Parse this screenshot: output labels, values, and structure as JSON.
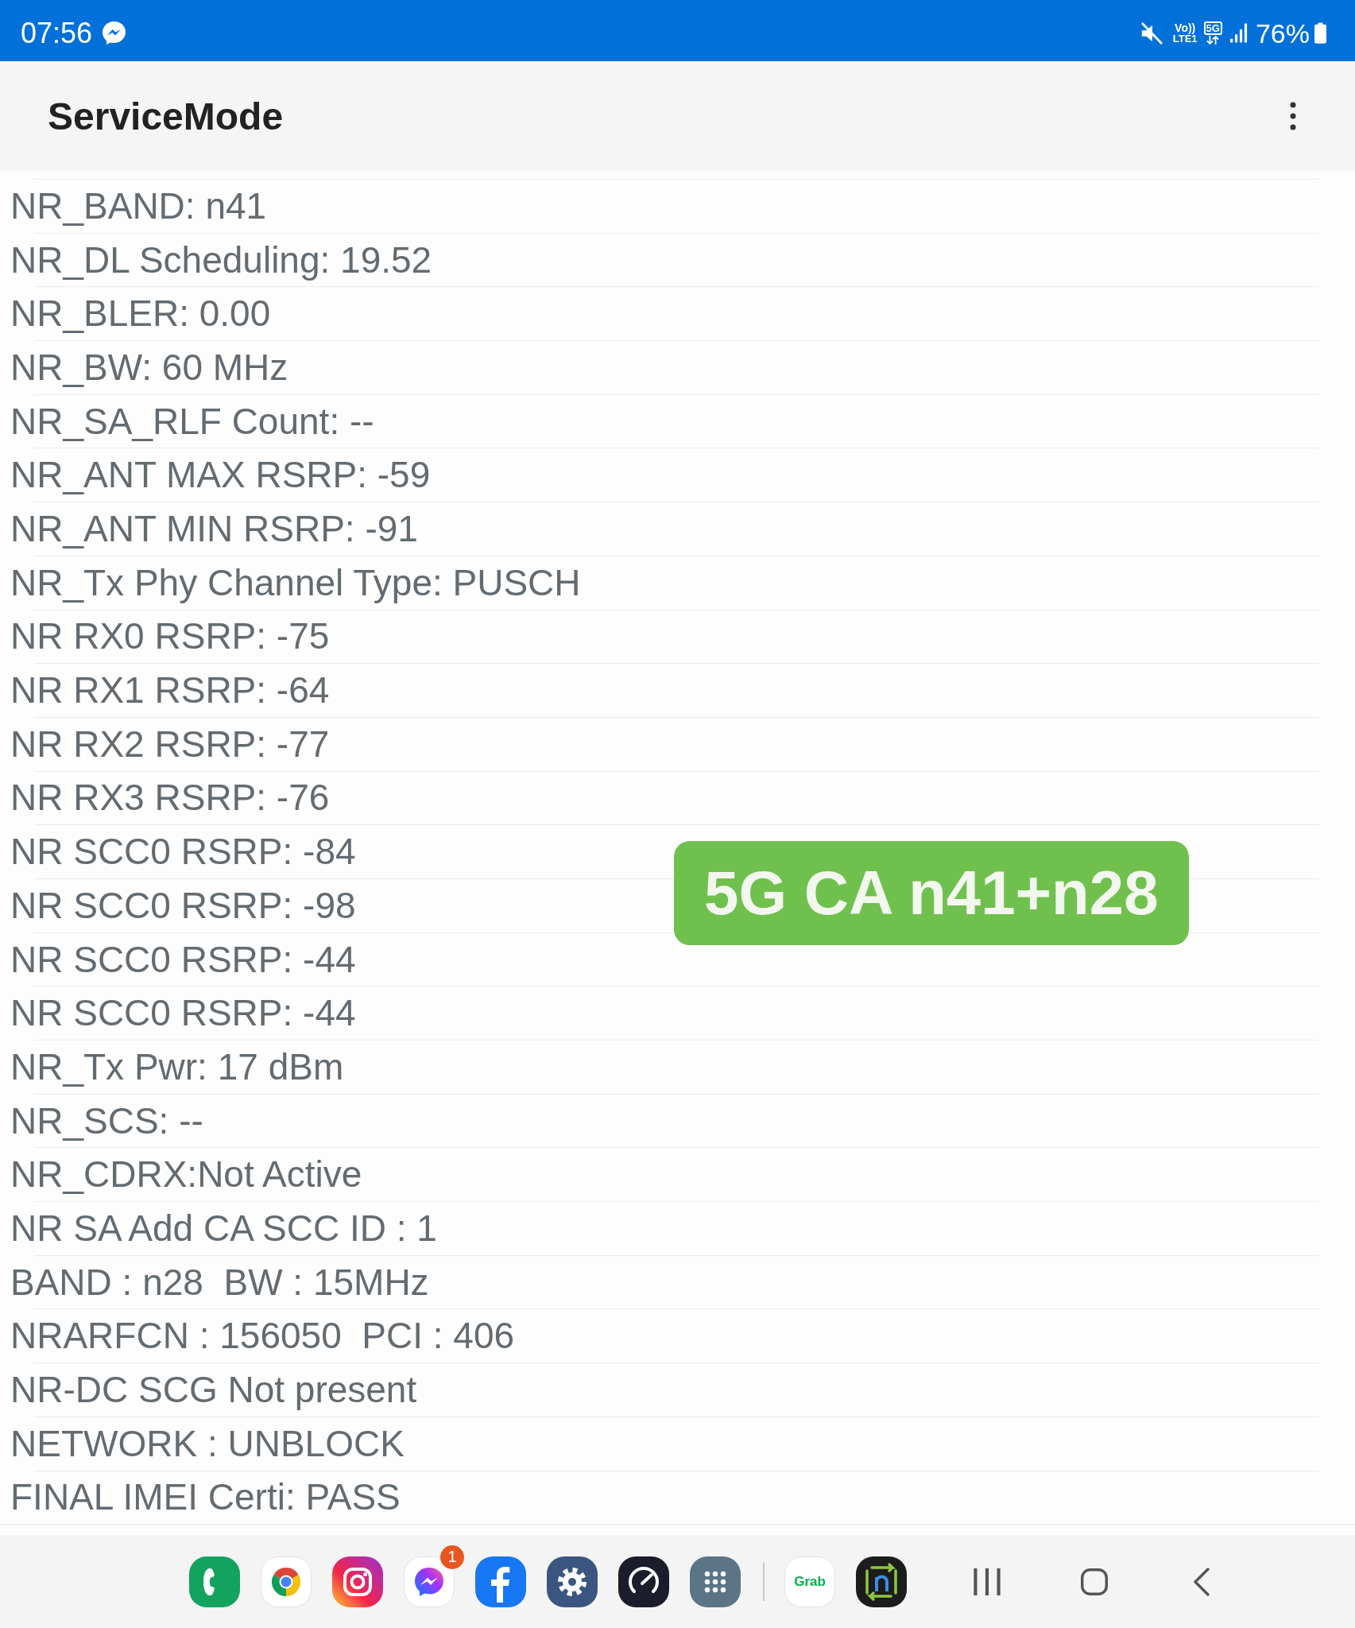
{
  "status_bar": {
    "time": "07:56",
    "volte_top": "Vo))",
    "volte_bottom": "LTE1",
    "network": "5G",
    "battery": "76%"
  },
  "app_bar": {
    "title": "ServiceMode"
  },
  "items": [
    "NR_BAND: n41",
    "NR_DL Scheduling: 19.52",
    "NR_BLER: 0.00",
    "NR_BW: 60 MHz",
    "NR_SA_RLF Count: --",
    "NR_ANT MAX RSRP: -59",
    "NR_ANT MIN RSRP: -91",
    "NR_Tx Phy Channel Type: PUSCH",
    "NR RX0 RSRP: -75",
    "NR RX1 RSRP: -64",
    "NR RX2 RSRP: -77",
    "NR RX3 RSRP: -76",
    "NR SCC0 RSRP: -84",
    "NR SCC0 RSRP: -98",
    "NR SCC0 RSRP: -44",
    "NR SCC0 RSRP: -44",
    "NR_Tx Pwr: 17 dBm",
    "NR_SCS: --",
    "NR_CDRX:Not Active",
    "NR SA Add CA SCC ID : 1",
    "BAND : n28  BW : 15MHz",
    "NRARFCN : 156050  PCI : 406",
    "NR-DC SCG Not present",
    "NETWORK : UNBLOCK",
    "FINAL IMEI Certi: PASS"
  ],
  "overlay_label": "5G CA n41+n28",
  "dock": {
    "pinned": [
      {
        "kind": "phone"
      },
      {
        "kind": "browser"
      },
      {
        "kind": "camera"
      },
      {
        "kind": "messenger",
        "badge": "1"
      },
      {
        "kind": "facebook"
      },
      {
        "kind": "settings"
      },
      {
        "kind": "speedometer"
      },
      {
        "kind": "app-grid"
      }
    ],
    "recent": [
      {
        "kind": "grab",
        "label": "Grab"
      },
      {
        "kind": "n-sync"
      }
    ]
  },
  "nav_buttons": [
    {
      "kind": "recents"
    },
    {
      "kind": "home"
    },
    {
      "kind": "back"
    }
  ]
}
